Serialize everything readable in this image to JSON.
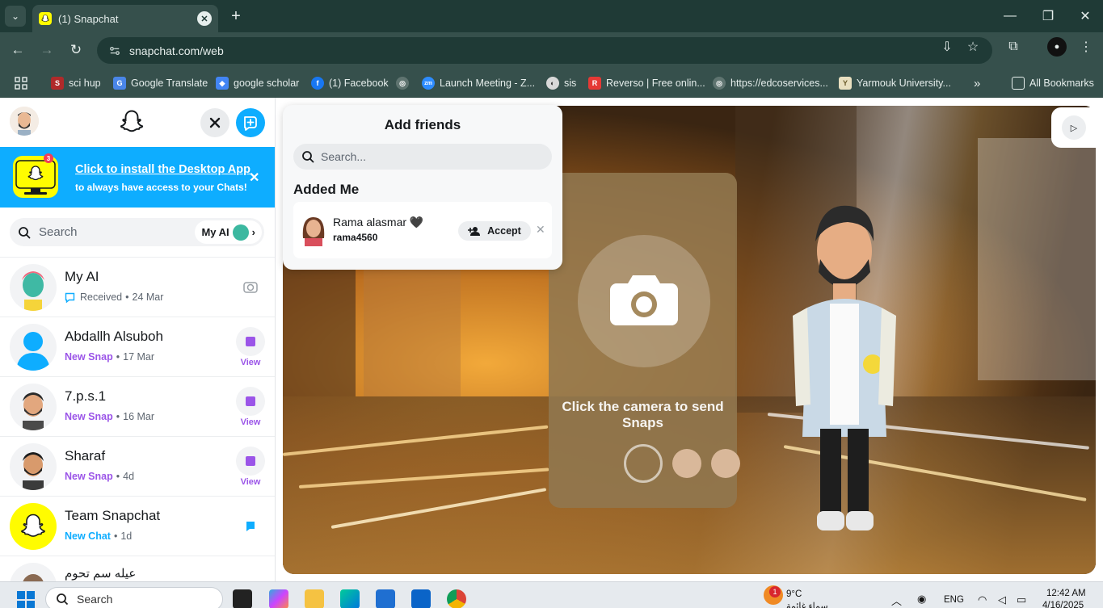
{
  "browser": {
    "tab_title": "(1) Snapchat",
    "url": "snapchat.com/web",
    "bookmarks": [
      {
        "label": "sci hup",
        "icon": "scihub-icon"
      },
      {
        "label": "Google Translate",
        "icon": "translate-icon"
      },
      {
        "label": "google scholar",
        "icon": "scholar-icon"
      },
      {
        "label": "(1) Facebook",
        "icon": "facebook-icon"
      },
      {
        "label": "",
        "icon": "globe-icon"
      },
      {
        "label": "Launch Meeting - Z...",
        "icon": "zoom-icon"
      },
      {
        "label": "sis",
        "icon": "sis-icon"
      },
      {
        "label": "Reverso | Free onlin...",
        "icon": "reverso-icon"
      },
      {
        "label": "https://edcoservices...",
        "icon": "globe-icon"
      },
      {
        "label": "Yarmouk University...",
        "icon": "yarmouk-icon"
      }
    ],
    "all_bookmarks": "All Bookmarks"
  },
  "sidebar": {
    "banner": {
      "badge": "3",
      "title": "Click to install the Desktop App",
      "subtitle": "to always have access to your Chats!"
    },
    "search_placeholder": "Search",
    "my_ai_chip": "My AI",
    "chats": [
      {
        "name": "My AI",
        "status": "Received",
        "status_color": "#5e6670",
        "time": "24 Mar",
        "action": "camera"
      },
      {
        "name": "Abdallh Alsuboh",
        "status": "New Snap",
        "status_color": "#9b55e8",
        "time": "17 Mar",
        "action": "View"
      },
      {
        "name": "7.p.s.1",
        "status": "New Snap",
        "status_color": "#9b55e8",
        "time": "16 Mar",
        "action": "View"
      },
      {
        "name": "Sharaf",
        "status": "New Snap",
        "status_color": "#9b55e8",
        "time": "4d",
        "action": "View"
      },
      {
        "name": "Team Snapchat",
        "status": "New Chat",
        "status_color": "#0eadff",
        "time": "1d",
        "action": "chat"
      },
      {
        "name": "عيله سم تحوم",
        "status": "",
        "status_color": "",
        "time": "",
        "action": ""
      }
    ]
  },
  "add_friends": {
    "title": "Add friends",
    "search_placeholder": "Search...",
    "section_title": "Added Me",
    "requests": [
      {
        "name": "Rama alasmar 🖤",
        "username": "rama4560",
        "accept_label": "Accept"
      }
    ]
  },
  "camera": {
    "prompt": "Click the camera to send Snaps"
  },
  "taskbar": {
    "search": "Search",
    "weather_temp": "9°C",
    "weather_badge": "1",
    "weather_desc": "سماء غائمة",
    "language": "ENG",
    "time": "12:42 AM",
    "date": "4/16/2025"
  },
  "colors": {
    "snap_yellow": "#fffc00",
    "snap_blue": "#0eadff",
    "snap_purple": "#9b55e8",
    "chrome_dark": "#1f3a36",
    "chrome_mid": "#36504c"
  }
}
